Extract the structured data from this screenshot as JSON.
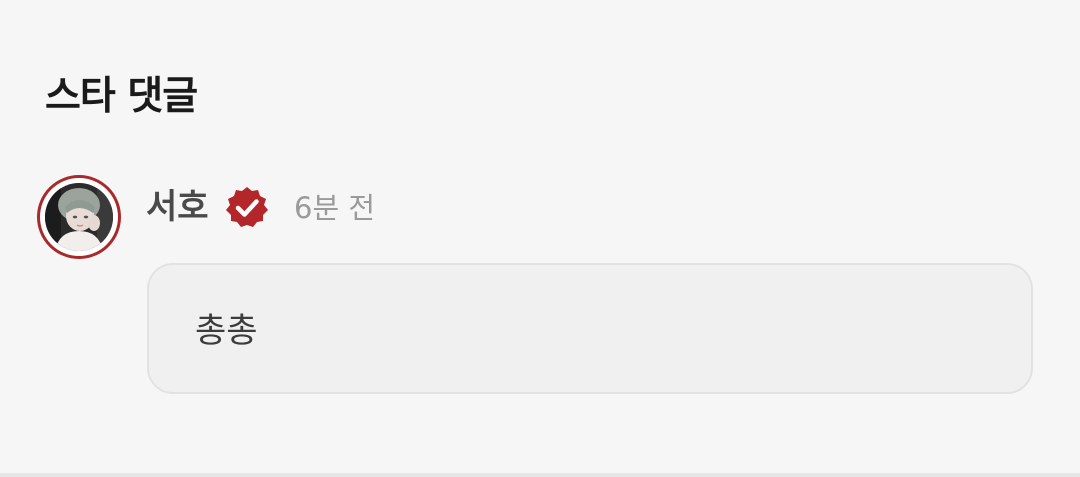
{
  "section": {
    "title": "스타 댓글"
  },
  "comment": {
    "author": "서호",
    "verified": true,
    "timestamp": "6분 전",
    "text": "총총"
  },
  "colors": {
    "background": "#f6f6f6",
    "accent": "#b3262a",
    "bubble": "#f0f0f0"
  },
  "icons": {
    "verified": "verified-badge-icon",
    "avatar": "user-avatar"
  }
}
